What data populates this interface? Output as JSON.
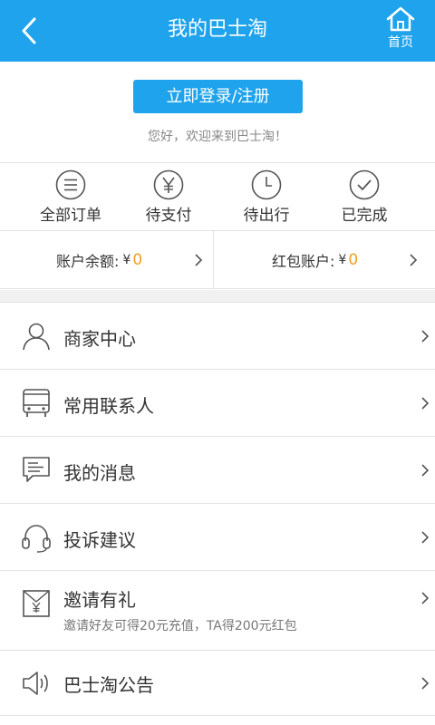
{
  "header": {
    "title": "我的巴士淘",
    "home_label": "首页"
  },
  "login": {
    "button_label": "立即登录/注册",
    "welcome": "您好，欢迎来到巴士淘！"
  },
  "orders": [
    {
      "label": "全部订单",
      "icon": "list-icon"
    },
    {
      "label": "待支付",
      "icon": "yen-icon"
    },
    {
      "label": "待出行",
      "icon": "clock-icon"
    },
    {
      "label": "已完成",
      "icon": "check-icon"
    }
  ],
  "accounts": {
    "balance": {
      "label": "账户余额:",
      "currency": "¥",
      "amount": "0"
    },
    "red_packet": {
      "label": "红包账户:",
      "currency": "¥",
      "amount": "0"
    }
  },
  "menu": [
    {
      "label": "商家中心",
      "icon": "user-icon"
    },
    {
      "label": "常用联系人",
      "icon": "bus-icon"
    },
    {
      "label": "我的消息",
      "icon": "message-icon"
    },
    {
      "label": "投诉建议",
      "icon": "headset-icon"
    },
    {
      "label": "邀请有礼",
      "icon": "gift-envelope-icon",
      "sub": "邀请好友可得20元充值，TA得200元红包"
    },
    {
      "label": "巴士淘公告",
      "icon": "speaker-icon"
    }
  ],
  "colors": {
    "primary": "#1fa3ec",
    "amount": "#f0a020",
    "divider": "#e2e2e2",
    "background_gap": "#f1f1f1"
  }
}
